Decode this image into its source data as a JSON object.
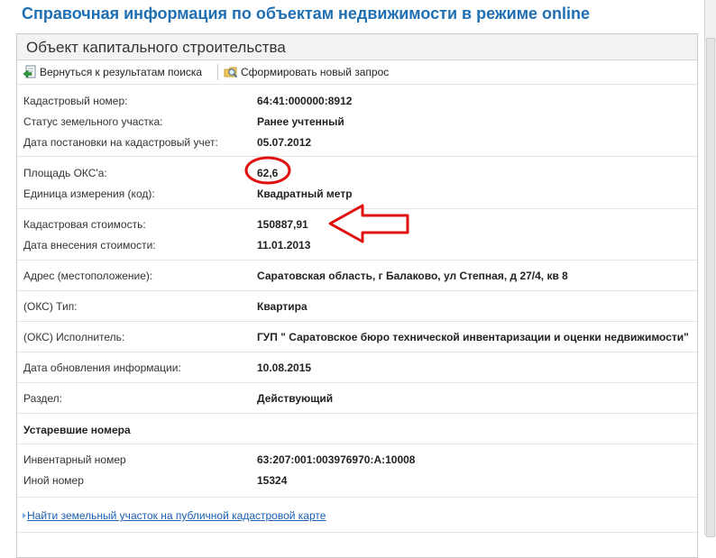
{
  "page": {
    "title": "Справочная информация по объектам недвижимости в режиме online"
  },
  "panel": {
    "title": "Объект капитального строительства"
  },
  "toolbar": {
    "back_label": "Вернуться к результатам поиска",
    "new_query_label": "Сформировать новый запрос"
  },
  "fields": [
    {
      "label": "Кадастровый номер:",
      "value": "64:41:000000:8912"
    },
    {
      "label": "Статус земельного участка:",
      "value": "Ранее учтенный"
    },
    {
      "label": "Дата постановки на кадастровый учет:",
      "value": "05.07.2012"
    },
    {
      "label": "Площадь ОКС'а:",
      "value": "62,6"
    },
    {
      "label": "Единица измерения (код):",
      "value": "Квадратный метр"
    },
    {
      "label": "Кадастровая стоимость:",
      "value": "150887,91"
    },
    {
      "label": "Дата внесения стоимости:",
      "value": "11.01.2013"
    },
    {
      "label": "Адрес (местоположение):",
      "value": "Саратовская область, г Балаково, ул Степная, д 27/4, кв 8"
    },
    {
      "label": "(ОКС) Тип:",
      "value": "Квартира"
    },
    {
      "label": "(ОКС) Исполнитель:",
      "value": "ГУП \" Саратовское бюро технической инвентаризации и оценки недвижимости\""
    },
    {
      "label": "Дата обновления информации:",
      "value": "10.08.2015"
    },
    {
      "label": "Раздел:",
      "value": "Действующий"
    }
  ],
  "old_numbers": {
    "title": "Устаревшие номера",
    "fields": [
      {
        "label": "Инвентарный номер",
        "value": "63:207:001:003976970:А:10008"
      },
      {
        "label": "Иной номер",
        "value": "15324"
      }
    ]
  },
  "map_link": {
    "label": "Найти земельный участок на публичной кадастровой карте"
  },
  "annotations": {
    "color": "#e01010"
  }
}
